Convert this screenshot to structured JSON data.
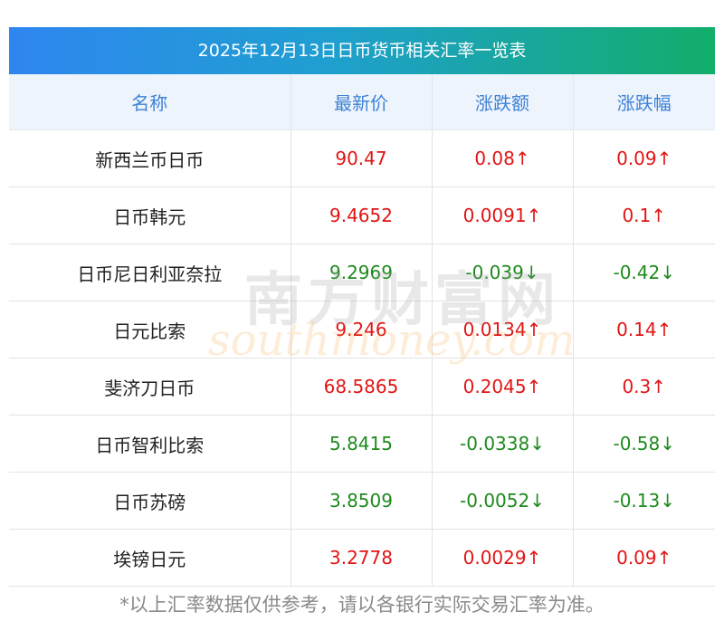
{
  "title": "2025年12月13日日币货币相关汇率一览表",
  "headers": [
    "名称",
    "最新价",
    "涨跌额",
    "涨跌幅"
  ],
  "rows": [
    {
      "name": "新西兰币日币",
      "price": "90.47",
      "change": "0.08↑",
      "pct": "0.09↑",
      "dir": "up"
    },
    {
      "name": "日币韩元",
      "price": "9.4652",
      "change": "0.0091↑",
      "pct": "0.1↑",
      "dir": "up"
    },
    {
      "name": "日币尼日利亚奈拉",
      "price": "9.2969",
      "change": "-0.039↓",
      "pct": "-0.42↓",
      "dir": "down"
    },
    {
      "name": "日元比索",
      "price": "9.246",
      "change": "0.0134↑",
      "pct": "0.14↑",
      "dir": "up"
    },
    {
      "name": "斐济刀日币",
      "price": "68.5865",
      "change": "0.2045↑",
      "pct": "0.3↑",
      "dir": "up"
    },
    {
      "name": "日币智利比索",
      "price": "5.8415",
      "change": "-0.0338↓",
      "pct": "-0.58↓",
      "dir": "down"
    },
    {
      "name": "日币苏磅",
      "price": "3.8509",
      "change": "-0.0052↓",
      "pct": "-0.13↓",
      "dir": "down"
    },
    {
      "name": "埃镑日元",
      "price": "3.2778",
      "change": "0.0029↑",
      "pct": "0.09↑",
      "dir": "up"
    }
  ],
  "watermark": {
    "cn": "南方财富网",
    "en": "southmoney.com"
  },
  "footnote": "*以上汇率数据仅供参考，请以各银行实际交易汇率为准。",
  "colors": {
    "up": "#e01515",
    "down": "#1e8a1e",
    "header_text": "#3d82d6",
    "title_from": "#2f86f0",
    "title_to": "#12ae6a"
  }
}
